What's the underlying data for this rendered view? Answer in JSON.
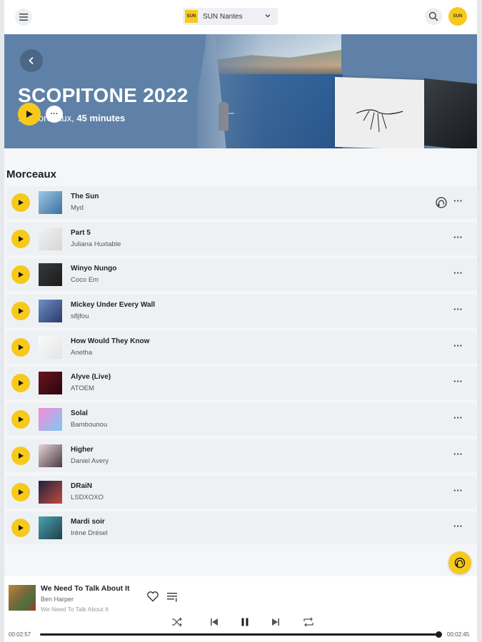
{
  "header": {
    "menu_icon": "hamburger-icon",
    "station": {
      "logo_text": "SUN",
      "name": "SUN Nantes"
    },
    "search_icon": "search-icon",
    "avatar_text": "SUN"
  },
  "hero": {
    "title": "SCOPITONE 2022",
    "subtitle_count": "10 morceaux, ",
    "subtitle_duration": "45 minutes",
    "more_label": "···"
  },
  "tracks_section": {
    "title": "Morceaux",
    "items": [
      {
        "title": "The Sun",
        "artist": "Myd",
        "thumb": [
          "#9ec7e3",
          "#3b6fa0"
        ],
        "cast": true
      },
      {
        "title": "Part 5",
        "artist": "Juliana Huxtable",
        "thumb": [
          "#f2f2f2",
          "#d6d6d6"
        ],
        "cast": false
      },
      {
        "title": "Winyo Nungo",
        "artist": "Coco Em",
        "thumb": [
          "#3a3a3a",
          "#1a1a1a"
        ],
        "cast": false
      },
      {
        "title": "Mickey Under Every Wall",
        "artist": "s8jfou",
        "thumb": [
          "#6f8fc9",
          "#2a3a66"
        ],
        "cast": false
      },
      {
        "title": "How Would They Know",
        "artist": "Anetha",
        "thumb": [
          "#fafafa",
          "#e4e4e4"
        ],
        "cast": false
      },
      {
        "title": "Alyve (Live)",
        "artist": "ATOEM",
        "thumb": [
          "#6a1420",
          "#2a060c"
        ],
        "cast": false
      },
      {
        "title": "Solal",
        "artist": "Bambounou",
        "thumb": [
          "#f58bd6",
          "#7ec9f2"
        ],
        "cast": false
      },
      {
        "title": "Higher",
        "artist": "Daniel Avery",
        "thumb": [
          "#e6d4d8",
          "#4a3a40"
        ],
        "cast": false
      },
      {
        "title": "DRaiN",
        "artist": "LSDXOXO",
        "thumb": [
          "#1d2340",
          "#c24a3c"
        ],
        "cast": false
      },
      {
        "title": "Mardi soir",
        "artist": "Irène Drésel",
        "thumb": [
          "#4aa3b0",
          "#1e3f4a"
        ],
        "cast": false
      }
    ],
    "more_label": "···"
  },
  "player": {
    "title": "We Need To Talk About It",
    "artist": "Ben Harper",
    "album": "We Need To Talk About It",
    "time_elapsed": "00:02:57",
    "time_total": "00:02:45",
    "progress": 1.0
  },
  "colors": {
    "accent": "#f7c91b",
    "hero": "#5f81a7",
    "background": "#f4f6f8"
  }
}
